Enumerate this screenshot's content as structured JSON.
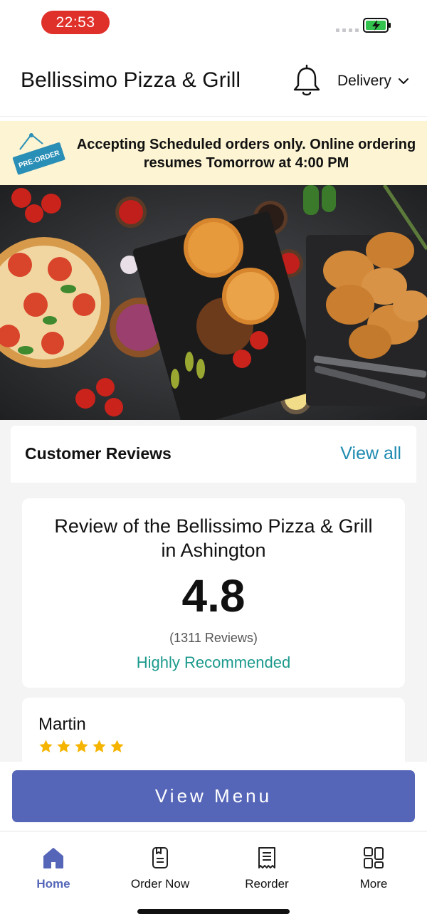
{
  "status_bar": {
    "time": "22:53"
  },
  "header": {
    "restaurant_name": "Bellissimo Pizza & Grill",
    "delivery_mode": "Delivery"
  },
  "banner": {
    "tag_label": "PRE-ORDER",
    "message_line1": "Accepting Scheduled orders only. Online ordering",
    "message_line2": "resumes Tomorrow at 4:00 PM"
  },
  "reviews": {
    "section_title": "Customer Reviews",
    "view_all_label": "View all",
    "summary": {
      "title_line1": "Review of the Bellissimo Pizza & Grill",
      "title_line2": "in Ashington",
      "rating": "4.8",
      "count_text": "(1311 Reviews)",
      "recommendation": "Highly Recommended"
    },
    "items": [
      {
        "reviewer": "Martin",
        "stars": 5
      }
    ]
  },
  "view_menu_label": "View Menu",
  "nav": {
    "items": [
      {
        "label": "Home",
        "icon": "home-icon",
        "active": true
      },
      {
        "label": "Order Now",
        "icon": "order-now-icon",
        "active": false
      },
      {
        "label": "Reorder",
        "icon": "receipt-icon",
        "active": false
      },
      {
        "label": "More",
        "icon": "grid-icon",
        "active": false
      }
    ]
  },
  "colors": {
    "accent": "#5566b8",
    "link": "#1f8bb0",
    "recommend": "#1c9a8c",
    "banner_bg": "#fcf4d2",
    "star": "#f5b400",
    "time_pill": "#e0302a"
  }
}
